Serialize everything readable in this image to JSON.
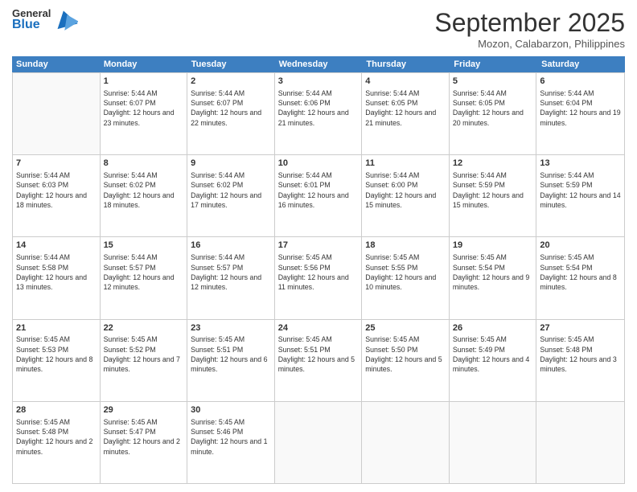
{
  "logo": {
    "general": "General",
    "blue": "Blue"
  },
  "title": "September 2025",
  "subtitle": "Mozon, Calabarzon, Philippines",
  "days": [
    "Sunday",
    "Monday",
    "Tuesday",
    "Wednesday",
    "Thursday",
    "Friday",
    "Saturday"
  ],
  "rows": [
    [
      {
        "day": "",
        "empty": true
      },
      {
        "day": "1",
        "sunrise": "Sunrise: 5:44 AM",
        "sunset": "Sunset: 6:07 PM",
        "daylight": "Daylight: 12 hours and 23 minutes."
      },
      {
        "day": "2",
        "sunrise": "Sunrise: 5:44 AM",
        "sunset": "Sunset: 6:07 PM",
        "daylight": "Daylight: 12 hours and 22 minutes."
      },
      {
        "day": "3",
        "sunrise": "Sunrise: 5:44 AM",
        "sunset": "Sunset: 6:06 PM",
        "daylight": "Daylight: 12 hours and 21 minutes."
      },
      {
        "day": "4",
        "sunrise": "Sunrise: 5:44 AM",
        "sunset": "Sunset: 6:05 PM",
        "daylight": "Daylight: 12 hours and 21 minutes."
      },
      {
        "day": "5",
        "sunrise": "Sunrise: 5:44 AM",
        "sunset": "Sunset: 6:05 PM",
        "daylight": "Daylight: 12 hours and 20 minutes."
      },
      {
        "day": "6",
        "sunrise": "Sunrise: 5:44 AM",
        "sunset": "Sunset: 6:04 PM",
        "daylight": "Daylight: 12 hours and 19 minutes."
      }
    ],
    [
      {
        "day": "7",
        "sunrise": "Sunrise: 5:44 AM",
        "sunset": "Sunset: 6:03 PM",
        "daylight": "Daylight: 12 hours and 18 minutes."
      },
      {
        "day": "8",
        "sunrise": "Sunrise: 5:44 AM",
        "sunset": "Sunset: 6:02 PM",
        "daylight": "Daylight: 12 hours and 18 minutes."
      },
      {
        "day": "9",
        "sunrise": "Sunrise: 5:44 AM",
        "sunset": "Sunset: 6:02 PM",
        "daylight": "Daylight: 12 hours and 17 minutes."
      },
      {
        "day": "10",
        "sunrise": "Sunrise: 5:44 AM",
        "sunset": "Sunset: 6:01 PM",
        "daylight": "Daylight: 12 hours and 16 minutes."
      },
      {
        "day": "11",
        "sunrise": "Sunrise: 5:44 AM",
        "sunset": "Sunset: 6:00 PM",
        "daylight": "Daylight: 12 hours and 15 minutes."
      },
      {
        "day": "12",
        "sunrise": "Sunrise: 5:44 AM",
        "sunset": "Sunset: 5:59 PM",
        "daylight": "Daylight: 12 hours and 15 minutes."
      },
      {
        "day": "13",
        "sunrise": "Sunrise: 5:44 AM",
        "sunset": "Sunset: 5:59 PM",
        "daylight": "Daylight: 12 hours and 14 minutes."
      }
    ],
    [
      {
        "day": "14",
        "sunrise": "Sunrise: 5:44 AM",
        "sunset": "Sunset: 5:58 PM",
        "daylight": "Daylight: 12 hours and 13 minutes."
      },
      {
        "day": "15",
        "sunrise": "Sunrise: 5:44 AM",
        "sunset": "Sunset: 5:57 PM",
        "daylight": "Daylight: 12 hours and 12 minutes."
      },
      {
        "day": "16",
        "sunrise": "Sunrise: 5:44 AM",
        "sunset": "Sunset: 5:57 PM",
        "daylight": "Daylight: 12 hours and 12 minutes."
      },
      {
        "day": "17",
        "sunrise": "Sunrise: 5:45 AM",
        "sunset": "Sunset: 5:56 PM",
        "daylight": "Daylight: 12 hours and 11 minutes."
      },
      {
        "day": "18",
        "sunrise": "Sunrise: 5:45 AM",
        "sunset": "Sunset: 5:55 PM",
        "daylight": "Daylight: 12 hours and 10 minutes."
      },
      {
        "day": "19",
        "sunrise": "Sunrise: 5:45 AM",
        "sunset": "Sunset: 5:54 PM",
        "daylight": "Daylight: 12 hours and 9 minutes."
      },
      {
        "day": "20",
        "sunrise": "Sunrise: 5:45 AM",
        "sunset": "Sunset: 5:54 PM",
        "daylight": "Daylight: 12 hours and 8 minutes."
      }
    ],
    [
      {
        "day": "21",
        "sunrise": "Sunrise: 5:45 AM",
        "sunset": "Sunset: 5:53 PM",
        "daylight": "Daylight: 12 hours and 8 minutes."
      },
      {
        "day": "22",
        "sunrise": "Sunrise: 5:45 AM",
        "sunset": "Sunset: 5:52 PM",
        "daylight": "Daylight: 12 hours and 7 minutes."
      },
      {
        "day": "23",
        "sunrise": "Sunrise: 5:45 AM",
        "sunset": "Sunset: 5:51 PM",
        "daylight": "Daylight: 12 hours and 6 minutes."
      },
      {
        "day": "24",
        "sunrise": "Sunrise: 5:45 AM",
        "sunset": "Sunset: 5:51 PM",
        "daylight": "Daylight: 12 hours and 5 minutes."
      },
      {
        "day": "25",
        "sunrise": "Sunrise: 5:45 AM",
        "sunset": "Sunset: 5:50 PM",
        "daylight": "Daylight: 12 hours and 5 minutes."
      },
      {
        "day": "26",
        "sunrise": "Sunrise: 5:45 AM",
        "sunset": "Sunset: 5:49 PM",
        "daylight": "Daylight: 12 hours and 4 minutes."
      },
      {
        "day": "27",
        "sunrise": "Sunrise: 5:45 AM",
        "sunset": "Sunset: 5:48 PM",
        "daylight": "Daylight: 12 hours and 3 minutes."
      }
    ],
    [
      {
        "day": "28",
        "sunrise": "Sunrise: 5:45 AM",
        "sunset": "Sunset: 5:48 PM",
        "daylight": "Daylight: 12 hours and 2 minutes."
      },
      {
        "day": "29",
        "sunrise": "Sunrise: 5:45 AM",
        "sunset": "Sunset: 5:47 PM",
        "daylight": "Daylight: 12 hours and 2 minutes."
      },
      {
        "day": "30",
        "sunrise": "Sunrise: 5:45 AM",
        "sunset": "Sunset: 5:46 PM",
        "daylight": "Daylight: 12 hours and 1 minute."
      },
      {
        "day": "",
        "empty": true
      },
      {
        "day": "",
        "empty": true
      },
      {
        "day": "",
        "empty": true
      },
      {
        "day": "",
        "empty": true
      }
    ]
  ]
}
